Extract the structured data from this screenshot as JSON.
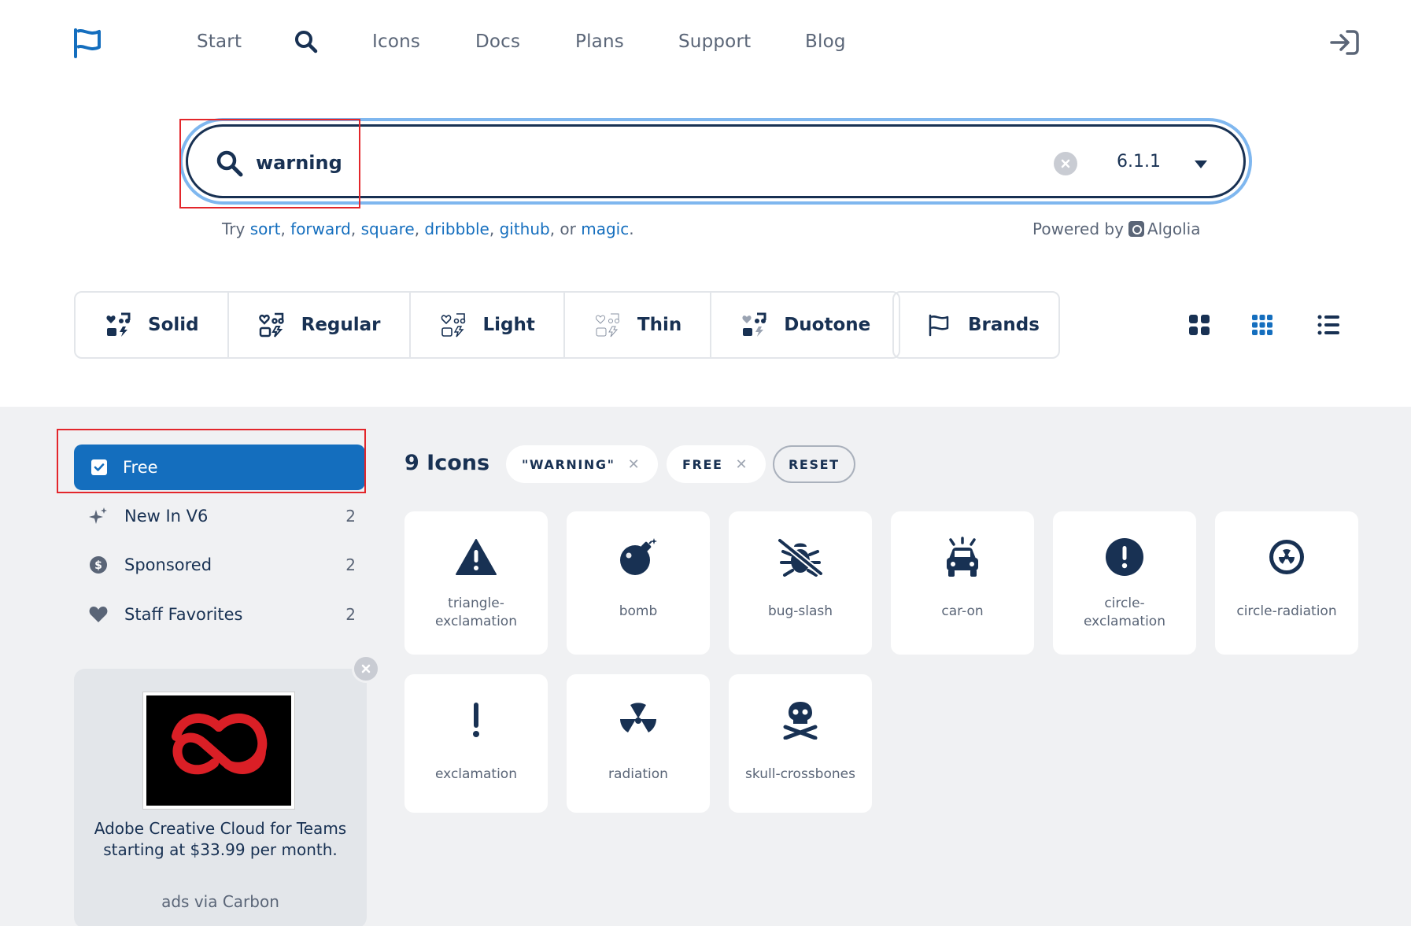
{
  "nav": {
    "links": [
      "Start",
      "Icons",
      "Docs",
      "Plans",
      "Support",
      "Blog"
    ]
  },
  "search": {
    "value": "warning",
    "version": "6.1.1"
  },
  "suggestions": {
    "prefix": "Try",
    "terms": [
      "sort",
      "forward",
      "square",
      "dribbble",
      "github",
      "magic"
    ],
    "or": "or",
    "powered_by": "Powered by",
    "provider": "Algolia"
  },
  "styles": [
    "Solid",
    "Regular",
    "Light",
    "Thin",
    "Duotone"
  ],
  "brands_label": "Brands",
  "filters": {
    "free": "Free",
    "items": [
      {
        "label": "New In V6",
        "count": "2",
        "icon": "sparkles-icon"
      },
      {
        "label": "Sponsored",
        "count": "2",
        "icon": "dollar-circle-icon"
      },
      {
        "label": "Staff Favorites",
        "count": "2",
        "icon": "heart-icon"
      }
    ]
  },
  "ad": {
    "text": "Adobe Creative Cloud for Teams starting at $33.99 per month.",
    "via": "ads via Carbon"
  },
  "results": {
    "count_label": "9 Icons",
    "chips": [
      "\"WARNING\"",
      "FREE"
    ],
    "reset": "RESET",
    "icons": [
      {
        "name": "triangle-exclamation",
        "line1": "triangle-",
        "line2": "exclamation"
      },
      {
        "name": "bomb",
        "line1": "bomb",
        "line2": ""
      },
      {
        "name": "bug-slash",
        "line1": "bug-slash",
        "line2": ""
      },
      {
        "name": "car-on",
        "line1": "car-on",
        "line2": ""
      },
      {
        "name": "circle-exclamation",
        "line1": "circle-",
        "line2": "exclamation"
      },
      {
        "name": "circle-radiation",
        "line1": "circle-radiation",
        "line2": ""
      },
      {
        "name": "exclamation",
        "line1": "exclamation",
        "line2": ""
      },
      {
        "name": "radiation",
        "line1": "radiation",
        "line2": ""
      },
      {
        "name": "skull-crossbones",
        "line1": "skull-crossbones",
        "line2": ""
      }
    ]
  },
  "colors": {
    "primary": "#183153",
    "accent": "#146ebe",
    "highlight": "#e3262b",
    "ad_red": "#da1f26"
  }
}
